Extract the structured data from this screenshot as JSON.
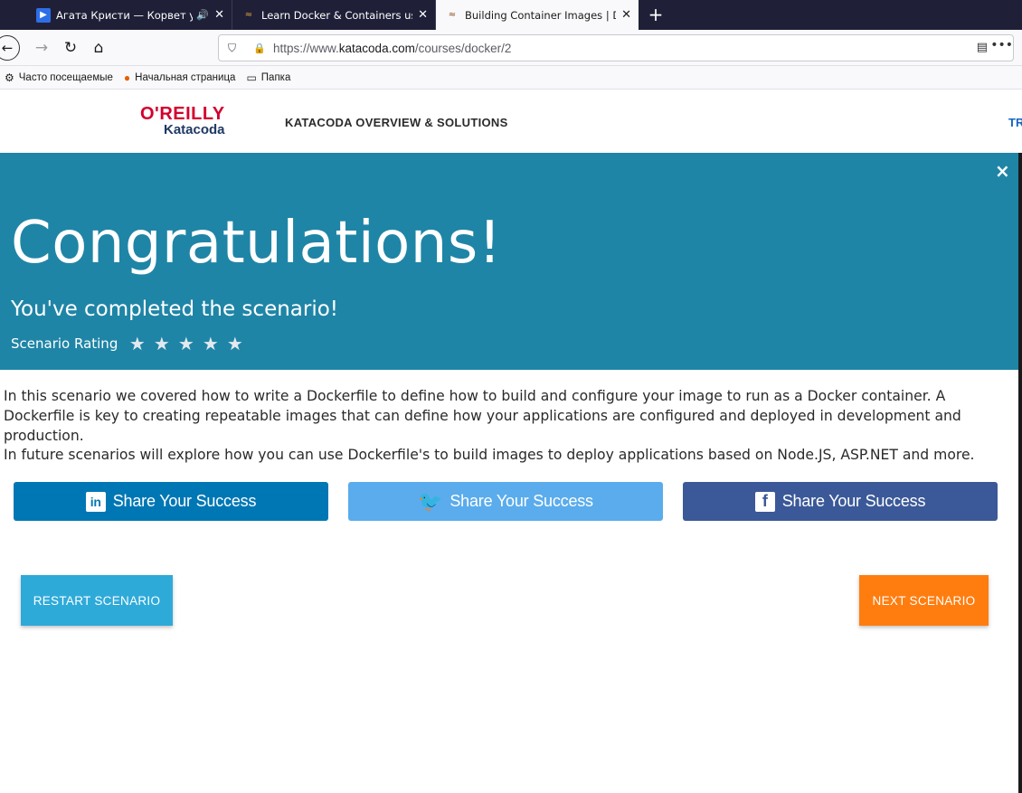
{
  "browser": {
    "tabs": [
      {
        "title": "Агата Кристи — Корвет ух",
        "favicon": "play-icon",
        "active": false,
        "audio": true
      },
      {
        "title": "Learn Docker & Containers usi",
        "favicon": "katacoda-icon",
        "active": false,
        "audio": false
      },
      {
        "title": "Building Container Images | Do",
        "favicon": "katacoda-icon",
        "active": true,
        "audio": false
      }
    ],
    "new_tab": "+",
    "url": {
      "prefix": "https://www.",
      "host": "katacoda.com",
      "path": "/courses/docker/2"
    },
    "bookmarks": [
      {
        "label": "Часто посещаемые",
        "icon": "gear-icon"
      },
      {
        "label": "Начальная страница",
        "icon": "firefox-icon"
      },
      {
        "label": "Папка",
        "icon": "folder-icon"
      }
    ]
  },
  "site": {
    "logo_top": "O'REILLY",
    "logo_bottom": "Katacoda",
    "nav_link": "KATACODA OVERVIEW & SOLUTIONS",
    "nav_link_right": "TR"
  },
  "banner": {
    "close": "×",
    "title": "Congratulations!",
    "subtitle": "You've completed the scenario!",
    "rating_label": "Scenario Rating",
    "rating_stars": 5
  },
  "content": {
    "paragraph1": "In this scenario we covered how to write a Dockerfile to define how to build and configure your image to run as a Docker container. A Dockerfile is key to creating repeatable images that can define how your applications are configured and deployed in development and production.",
    "paragraph2": "In future scenarios will explore how you can use Dockerfile's to build images to deploy applications based on Node.JS, ASP.NET and more."
  },
  "share": {
    "linkedin_label": "Share Your Success",
    "twitter_label": "Share Your Success",
    "facebook_label": "Share Your Success"
  },
  "actions": {
    "restart_label": "RESTART SCENARIO",
    "next_label": "NEXT SCENARIO"
  },
  "colors": {
    "banner": "#1f85a6",
    "linkedin": "#0077b5",
    "twitter": "#5aacec",
    "facebook": "#3b5998",
    "restart": "#2eaad9",
    "next": "#ff7d0f"
  }
}
